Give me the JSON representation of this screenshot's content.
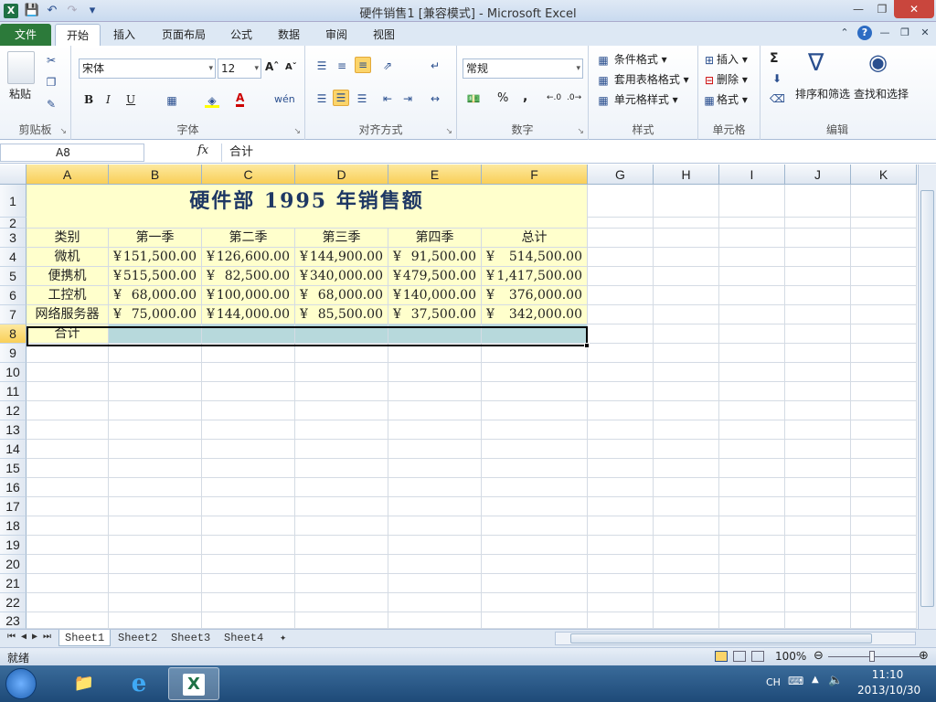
{
  "window": {
    "title": "硬件销售1  [兼容模式] - Microsoft Excel",
    "app_icon": "X"
  },
  "qat": {
    "save": "save-icon",
    "undo": "undo-icon",
    "redo": "redo-icon",
    "customize": "dropdown-icon"
  },
  "tabs": [
    {
      "label": "文件"
    },
    {
      "label": "开始"
    },
    {
      "label": "插入"
    },
    {
      "label": "页面布局"
    },
    {
      "label": "公式"
    },
    {
      "label": "数据"
    },
    {
      "label": "审阅"
    },
    {
      "label": "视图"
    }
  ],
  "ribbon": {
    "clipboard": {
      "label": "剪贴板",
      "paste": "粘贴"
    },
    "font": {
      "label": "字体",
      "name": "宋体",
      "size": "12",
      "bold": "B",
      "italic": "I",
      "underline": "U",
      "color_letter": "A",
      "wen": "wén"
    },
    "alignment": {
      "label": "对齐方式"
    },
    "number": {
      "label": "数字",
      "format": "常规",
      "percent": "%",
      "comma": ","
    },
    "styles": {
      "label": "样式",
      "conditional": "条件格式",
      "table": "套用表格格式",
      "cell": "单元格样式"
    },
    "cells": {
      "label": "单元格",
      "insert": "插入",
      "delete": "删除",
      "format": "格式"
    },
    "editing": {
      "label": "编辑",
      "sigma": "Σ",
      "sort": "排序和筛选",
      "find": "查找和选择"
    }
  },
  "formula_bar": {
    "name_box": "A8",
    "fx": "fx",
    "value": "合计"
  },
  "columns": [
    "A",
    "B",
    "C",
    "D",
    "E",
    "F",
    "G",
    "H",
    "I",
    "J",
    "K"
  ],
  "rows": [
    "1",
    "2",
    "3",
    "4",
    "5",
    "6",
    "7",
    "8",
    "9",
    "10",
    "11",
    "12",
    "13",
    "14",
    "15",
    "16",
    "17",
    "18",
    "19",
    "20",
    "21",
    "22",
    "23"
  ],
  "sheet": {
    "title": "硬件部 1995 年销售额",
    "currency": "¥",
    "headers": [
      "类别",
      "第一季",
      "第二季",
      "第三季",
      "第四季",
      "总计"
    ],
    "data": [
      {
        "label": "微机",
        "values": [
          "151,500.00",
          "126,600.00",
          "144,900.00",
          "91,500.00",
          "514,500.00"
        ]
      },
      {
        "label": "便携机",
        "values": [
          "515,500.00",
          "82,500.00",
          "340,000.00",
          "479,500.00",
          "1,417,500.00"
        ]
      },
      {
        "label": "工控机",
        "values": [
          "68,000.00",
          "100,000.00",
          "68,000.00",
          "140,000.00",
          "376,000.00"
        ]
      },
      {
        "label": "网络服务器",
        "values": [
          "75,000.00",
          "144,000.00",
          "85,500.00",
          "37,500.00",
          "342,000.00"
        ]
      }
    ],
    "total_label": "合计"
  },
  "sheet_tabs": [
    "Sheet1",
    "Sheet2",
    "Sheet3",
    "Sheet4"
  ],
  "status": {
    "ready": "就绪",
    "zoom": "100%"
  },
  "taskbar": {
    "ime": "CH",
    "time": "11:10",
    "date": "2013/10/30"
  }
}
